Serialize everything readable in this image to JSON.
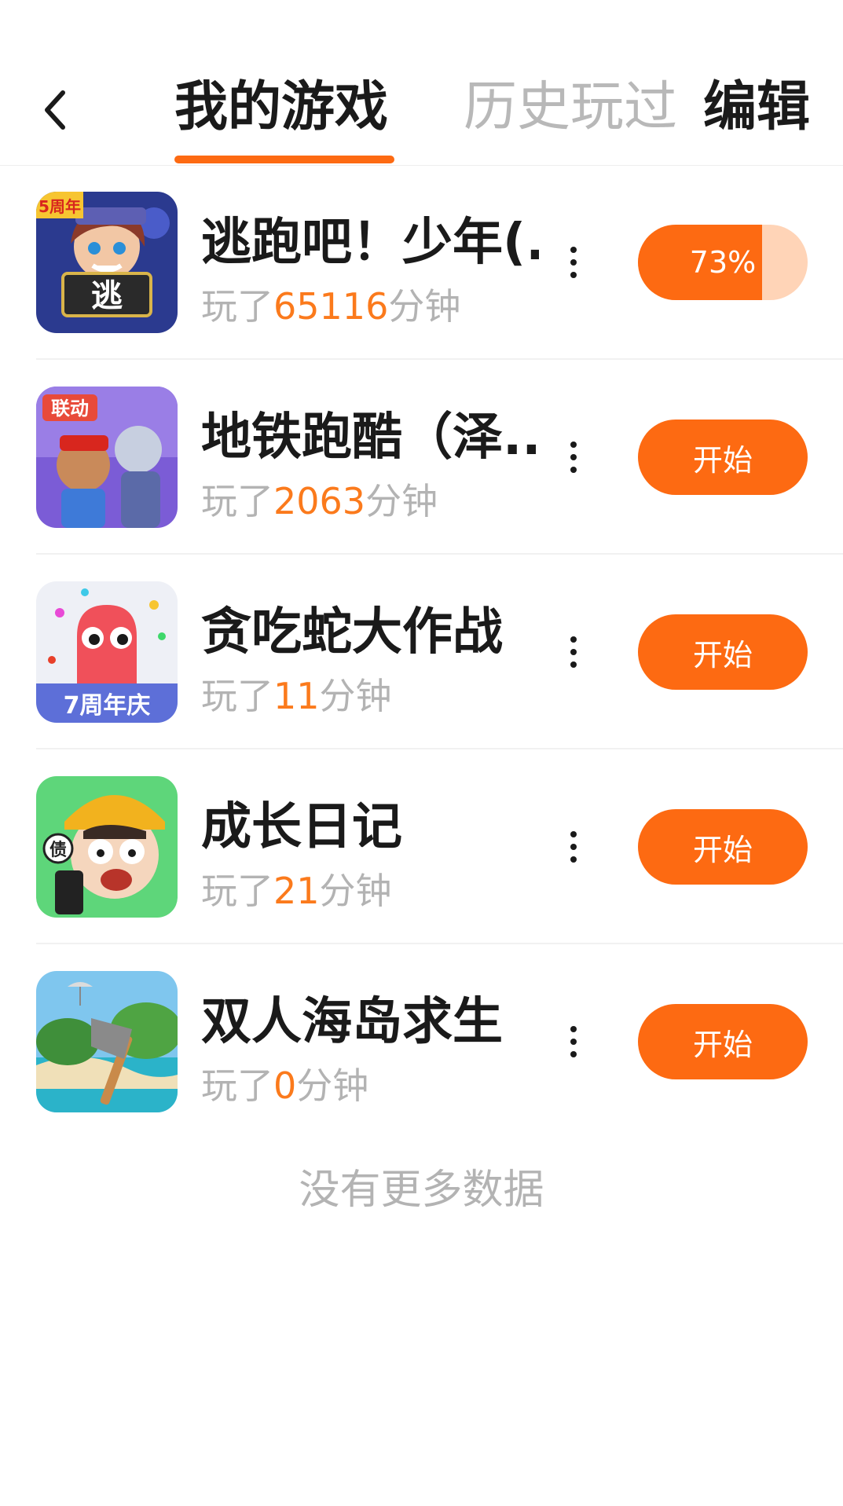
{
  "header": {
    "tab_mine": "我的游戏",
    "tab_history": "历史玩过",
    "edit": "编辑"
  },
  "games": [
    {
      "title": "逃跑吧！少年(...",
      "played_prefix": "玩了",
      "minutes": "65116",
      "played_suffix": "分钟",
      "action": "73%",
      "progress": 0.73,
      "icon": "escape-game-icon",
      "icon_badge": "逃",
      "icon_tag": "5周年"
    },
    {
      "title": "地铁跑酷（泽...",
      "played_prefix": "玩了",
      "minutes": "2063",
      "played_suffix": "分钟",
      "action": "开始",
      "icon": "subway-surfers-icon",
      "icon_tag": "联动"
    },
    {
      "title": "贪吃蛇大作战",
      "played_prefix": "玩了",
      "minutes": "11",
      "played_suffix": "分钟",
      "action": "开始",
      "icon": "snake-game-icon",
      "icon_tag": "7周年庆"
    },
    {
      "title": "成长日记",
      "played_prefix": "玩了",
      "minutes": "21",
      "played_suffix": "分钟",
      "action": "开始",
      "icon": "growth-diary-icon",
      "icon_tag": "债"
    },
    {
      "title": "双人海岛求生",
      "played_prefix": "玩了",
      "minutes": "0",
      "played_suffix": "分钟",
      "action": "开始",
      "icon": "island-survival-icon"
    }
  ],
  "footer": "没有更多数据",
  "colors": {
    "accent": "#fd6a12",
    "progress_track": "#ffd4b7",
    "muted": "#b3b3b3"
  }
}
